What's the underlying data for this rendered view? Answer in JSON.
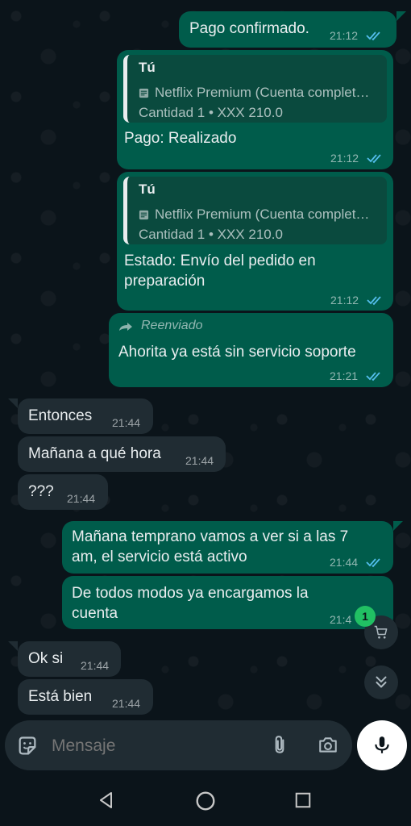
{
  "chat": {
    "messages": [
      {
        "type": "outgoing",
        "text": "Pago confirmado.",
        "time": "21:12"
      },
      {
        "type": "outgoing_reply",
        "quote_author": "Tú",
        "quote_product": "Netflix Premium (Cuenta complet…",
        "quote_detail": "Cantidad 1 • XXX 210.0",
        "text": "Pago: Realizado",
        "time": "21:12"
      },
      {
        "type": "outgoing_reply",
        "quote_author": "Tú",
        "quote_product": "Netflix Premium (Cuenta complet…",
        "quote_detail": "Cantidad 1 • XXX 210.0",
        "text_line1": "Estado: Envío del pedido en",
        "text_line2": "preparación",
        "time": "21:12"
      },
      {
        "type": "outgoing_forwarded",
        "forward_label": "Reenviado",
        "text": "Ahorita ya está sin servicio soporte",
        "time": "21:21"
      },
      {
        "type": "incoming",
        "text": "Entonces",
        "time": "21:44"
      },
      {
        "type": "incoming",
        "text": "Mañana a qué hora",
        "time": "21:44"
      },
      {
        "type": "incoming",
        "text": "???",
        "time": "21:44"
      },
      {
        "type": "outgoing",
        "text_line1": "Mañana temprano vamos a ver si a las 7",
        "text_line2": "am, el servicio está activo",
        "time": "21:44"
      },
      {
        "type": "outgoing",
        "text_line1": "De todos modos ya encargamos la",
        "text_line2": "cuenta",
        "time": "21:4"
      },
      {
        "type": "incoming",
        "text": "Ok si",
        "time": "21:44"
      },
      {
        "type": "incoming",
        "text": "Está bien",
        "time": "21:44"
      }
    ]
  },
  "cart_fab": {
    "badge_count": "1",
    "icon": "cart-icon"
  },
  "scroll_fab": {
    "icon": "double-chevron-down-icon"
  },
  "composer": {
    "placeholder": "Mensaje",
    "sticker_icon": "sticker-icon",
    "attach_icon": "paperclip-icon",
    "camera_icon": "camera-icon",
    "mic_icon": "mic-icon"
  },
  "navbar": {
    "back_icon": "back-triangle-icon",
    "home_icon": "home-circle-icon",
    "recents_icon": "recents-square-icon"
  },
  "colors": {
    "outgoing_bubble": "#005c4b",
    "incoming_bubble": "#202c33",
    "read_ticks": "#53bdeb",
    "badge": "#21c063",
    "background": "#0b141a"
  }
}
